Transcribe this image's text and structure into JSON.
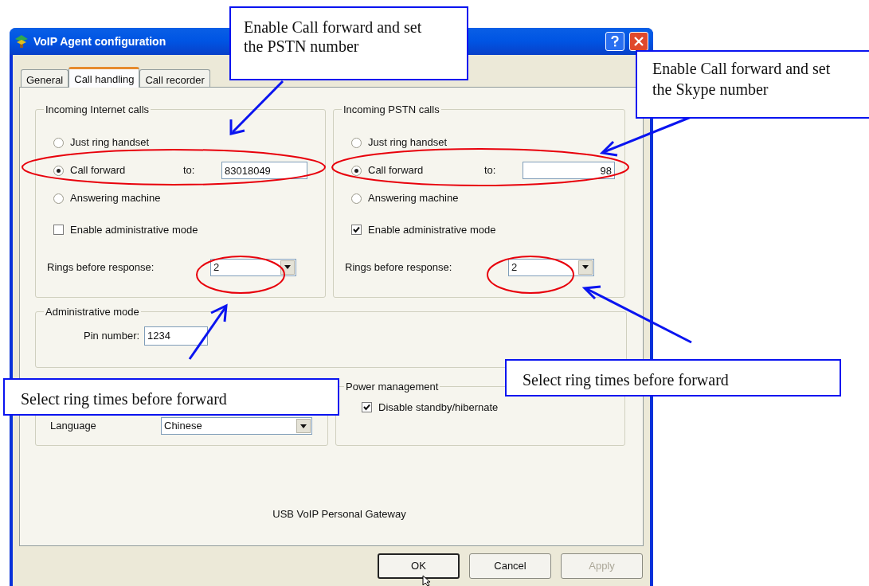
{
  "window": {
    "title": "VoIP Agent configuration"
  },
  "tabs": [
    {
      "label": "General",
      "selected": false
    },
    {
      "label": "Call handling",
      "selected": true
    },
    {
      "label": "Call recorder",
      "selected": false
    }
  ],
  "groups": [
    {
      "title": "Incoming Internet calls",
      "options": [
        {
          "label": "Just ring handset",
          "selected": false
        },
        {
          "label": "Call forward",
          "selected": true
        },
        {
          "label": "Answering machine",
          "selected": false
        }
      ],
      "forward_label": "to:",
      "forward_value": "83018049",
      "admin_checkbox": {
        "label": "Enable administrative mode",
        "checked": false
      },
      "rings": {
        "label": "Rings before response:",
        "value": "2"
      }
    },
    {
      "title": "Incoming PSTN calls",
      "options": [
        {
          "label": "Just ring handset",
          "selected": false
        },
        {
          "label": "Call forward",
          "selected": true
        },
        {
          "label": "Answering machine",
          "selected": false
        }
      ],
      "forward_label": "to:",
      "forward_value": "98",
      "admin_checkbox": {
        "label": "Enable administrative mode",
        "checked": true
      },
      "rings": {
        "label": "Rings before response:",
        "value": "2"
      }
    }
  ],
  "admin_mode": {
    "title": "Administrative mode",
    "pin_label": "Pin number:",
    "pin_value": "1234"
  },
  "language": {
    "label": "Language",
    "value": "Chinese"
  },
  "power": {
    "title": "Power management",
    "checkbox": {
      "label": "Disable standby/hibernate",
      "checked": true
    }
  },
  "footer": "USB VoIP Personal Gateway",
  "buttons": [
    {
      "label": "OK",
      "default": true,
      "disabled": false
    },
    {
      "label": "Cancel",
      "default": false,
      "disabled": false
    },
    {
      "label": "Apply",
      "default": false,
      "disabled": true
    }
  ],
  "annotations": [
    "Enable Call forward and set the PSTN number",
    "Enable Call forward and set the Skype number",
    "Select ring times before forward",
    "Select ring times before forward"
  ]
}
